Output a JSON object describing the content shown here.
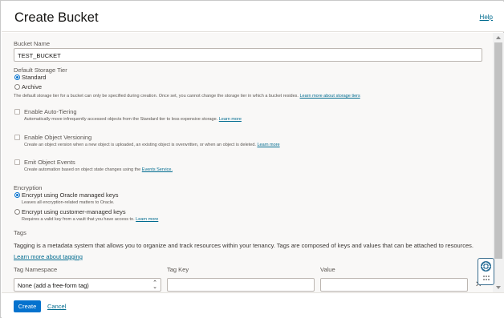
{
  "header": {
    "title": "Create Bucket",
    "help_label": "Help"
  },
  "bucket_name": {
    "label": "Bucket Name",
    "value": "TEST_BUCKET"
  },
  "storage_tier": {
    "label": "Default Storage Tier",
    "options": [
      {
        "label": "Standard",
        "selected": true
      },
      {
        "label": "Archive",
        "selected": false
      }
    ],
    "note": "The default storage tier for a bucket can only be specified during creation. Once set, you cannot change the storage tier in which a bucket resides.",
    "note_link": "Learn more about storage tiers"
  },
  "auto_tiering": {
    "label": "Enable Auto-Tiering",
    "checked": false,
    "desc": "Automatically move infrequently accessed objects from the Standard tier to less expensive storage.",
    "link": "Learn more"
  },
  "versioning": {
    "label": "Enable Object Versioning",
    "checked": false,
    "desc": "Create an object version when a new object is uploaded, an existing object is overwritten, or when an object is deleted.",
    "link": "Learn more"
  },
  "events": {
    "label": "Emit Object Events",
    "checked": false,
    "desc": "Create automation based on object state changes using the",
    "link": "Events Service."
  },
  "encryption": {
    "label": "Encryption",
    "options": [
      {
        "label": "Encrypt using Oracle managed keys",
        "desc": "Leaves all encryption-related matters to Oracle.",
        "link": "",
        "selected": true
      },
      {
        "label": "Encrypt using customer-managed keys",
        "desc": "Requires a valid key from a vault that you have access to.",
        "link": "Learn more",
        "selected": false
      }
    ]
  },
  "tags": {
    "label": "Tags",
    "desc": "Tagging is a metadata system that allows you to organize and track resources within your tenancy. Tags are composed of keys and values that can be attached to resources.",
    "link": "Learn more about tagging",
    "namespace_label": "Tag Namespace",
    "key_label": "Tag Key",
    "value_label": "Value",
    "namespace_value": "None (add a free-form tag)",
    "key_value": "",
    "value_value": ""
  },
  "footer": {
    "create_label": "Create",
    "cancel_label": "Cancel"
  },
  "colors": {
    "primary": "#0572ce",
    "link": "#006b8f",
    "text": "#312d2a",
    "panel_bg": "#f9f8f7"
  },
  "icons": {
    "float_help": "lifebuoy-icon",
    "close": "close-icon",
    "select": "updown-chevron-icon"
  }
}
